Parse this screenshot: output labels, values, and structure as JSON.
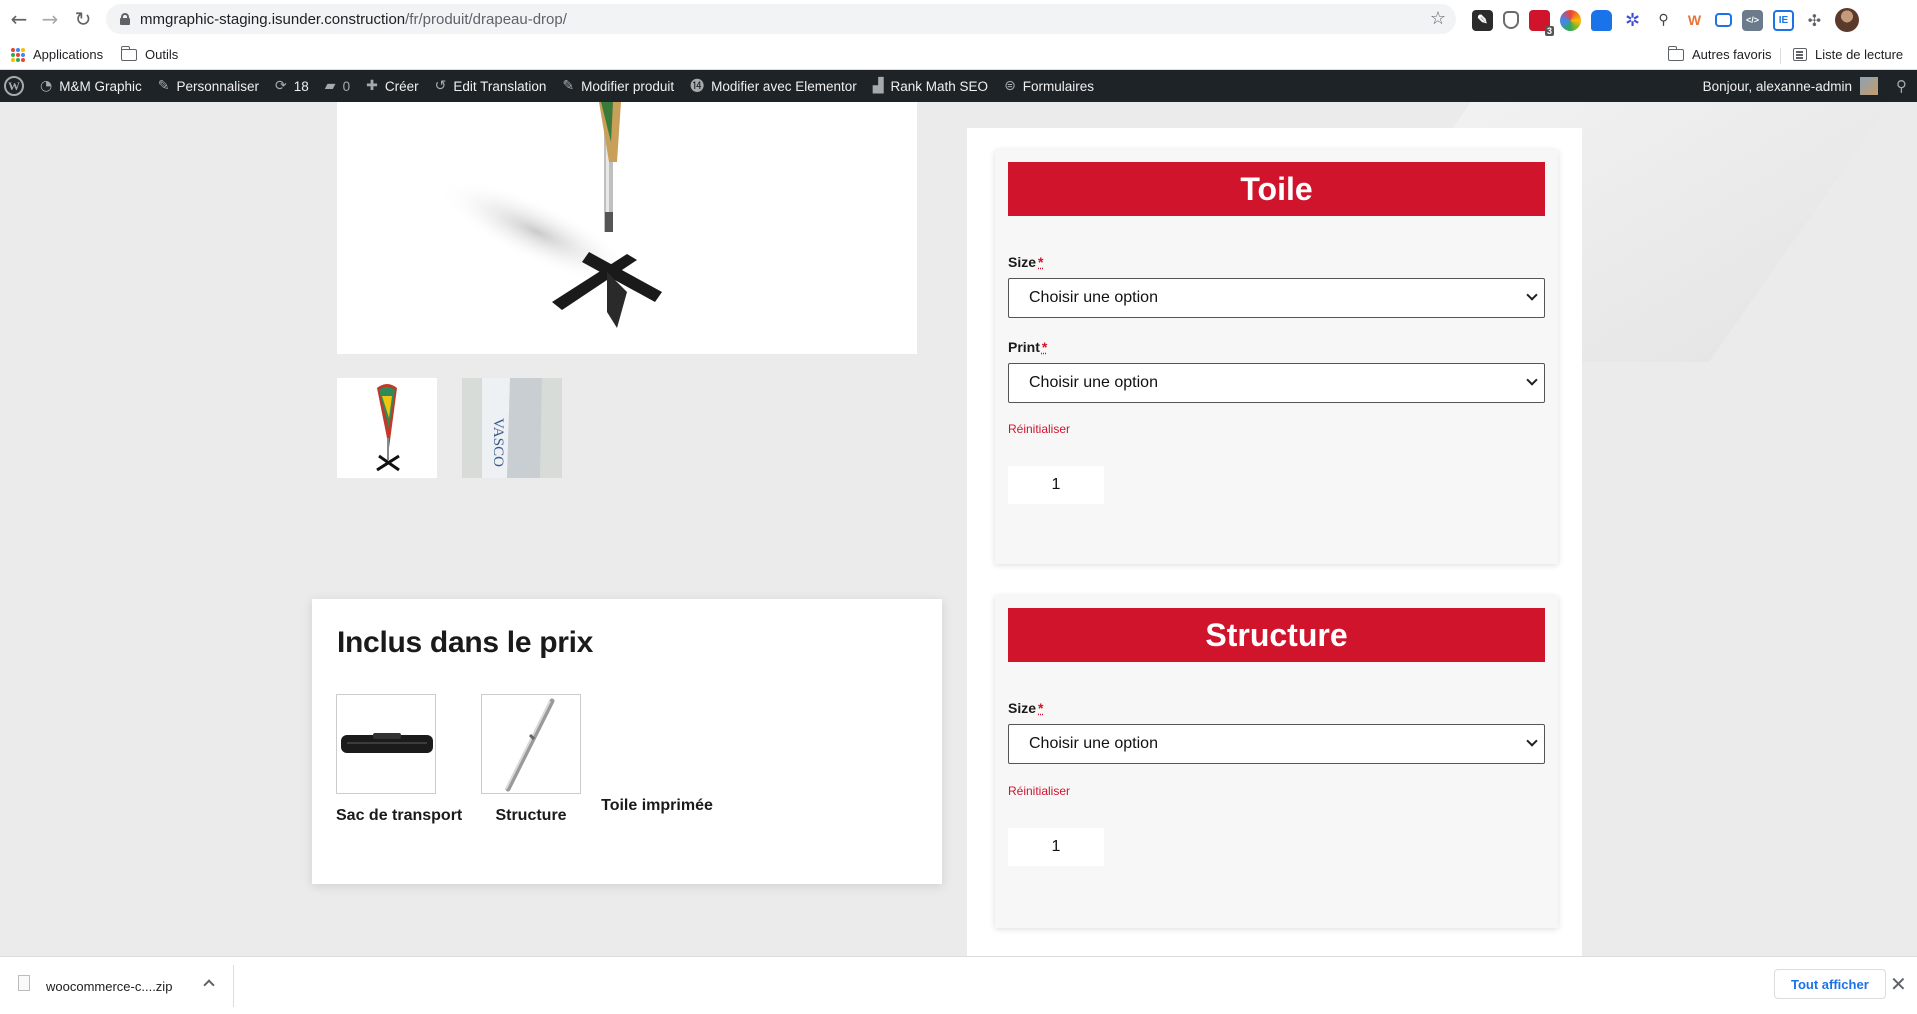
{
  "browser": {
    "url_host": "mmgraphic-staging.isunder.construction",
    "url_path": "/fr/produit/drapeau-drop/",
    "bookmarks": {
      "apps": "Applications",
      "tools": "Outils",
      "other_favorites": "Autres favoris",
      "reading_list": "Liste de lecture"
    },
    "extension_badge": "3"
  },
  "adminbar": {
    "site_name": "M&M Graphic",
    "customize": "Personnaliser",
    "updates_count": "18",
    "comments_count": "0",
    "create": "Créer",
    "edit_translation": "Edit Translation",
    "edit_product": "Modifier produit",
    "edit_elementor": "Modifier avec Elementor",
    "rank_math": "Rank Math SEO",
    "forms": "Formulaires",
    "greeting": "Bonjour, alexanne-admin"
  },
  "included": {
    "title": "Inclus dans le prix",
    "items": [
      {
        "label": "Sac de transport"
      },
      {
        "label": "Structure"
      },
      {
        "label": "Toile imprimée"
      }
    ]
  },
  "cards": {
    "toile": {
      "title": "Toile",
      "size_label": "Size",
      "size_value": "Choisir une option",
      "print_label": "Print",
      "print_value": "Choisir une option",
      "reset": "Réinitialiser",
      "quantity": "1"
    },
    "structure": {
      "title": "Structure",
      "size_label": "Size",
      "size_value": "Choisir une option",
      "reset": "Réinitialiser",
      "quantity": "1"
    },
    "required_mark": "*"
  },
  "download_bar": {
    "file_name": "woocommerce-c....zip",
    "show_all": "Tout afficher"
  },
  "colors": {
    "brand_red": "#d0142c",
    "adminbar_bg": "#1d2327",
    "link_blue": "#1a73e8"
  }
}
